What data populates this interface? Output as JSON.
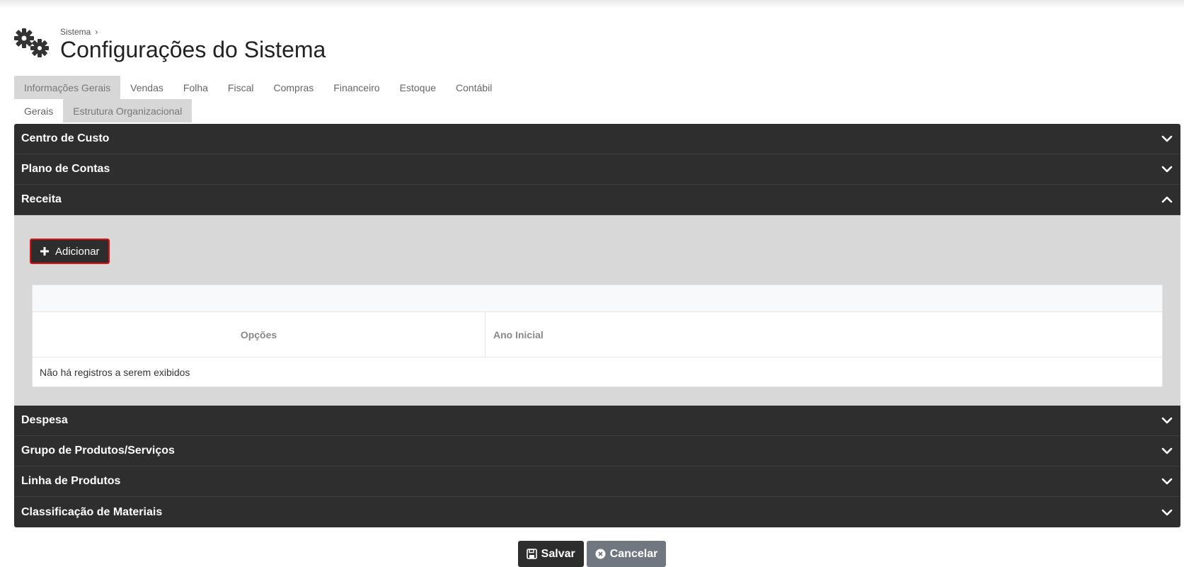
{
  "breadcrumb": {
    "parent": "Sistema",
    "separator": "›"
  },
  "page": {
    "title": "Configurações do Sistema"
  },
  "tabs": [
    {
      "label": "Informações Gerais",
      "active": true
    },
    {
      "label": "Vendas"
    },
    {
      "label": "Folha"
    },
    {
      "label": "Fiscal"
    },
    {
      "label": "Compras"
    },
    {
      "label": "Financeiro"
    },
    {
      "label": "Estoque"
    },
    {
      "label": "Contábil"
    }
  ],
  "subtabs": [
    {
      "label": "Gerais"
    },
    {
      "label": "Estrutura Organizacional",
      "active": true
    }
  ],
  "sections": [
    {
      "label": "Centro de Custo",
      "icon": "chevron-down-icon"
    },
    {
      "label": "Plano de Contas",
      "icon": "chevron-down-icon"
    },
    {
      "label": "Receita",
      "icon": "chevron-up-icon",
      "expanded": true
    },
    {
      "label": "Despesa",
      "icon": "chevron-down-icon"
    },
    {
      "label": "Grupo de Produtos/Serviços",
      "icon": "chevron-down-icon"
    },
    {
      "label": "Linha de Produtos",
      "icon": "chevron-down-icon"
    },
    {
      "label": "Classificação de Materiais",
      "icon": "chevron-down-icon"
    }
  ],
  "receita": {
    "add_label": "Adicionar",
    "columns": [
      "Opções",
      "Ano Inicial"
    ],
    "empty_message": "Não há registros a serem exibidos"
  },
  "footer": {
    "save_label": "Salvar",
    "cancel_label": "Cancelar"
  },
  "colors": {
    "header_dark": "#2e2e2e",
    "panel_gray": "#d8d8d8",
    "highlight_red": "#e01010",
    "cancel_gray": "#707780"
  }
}
